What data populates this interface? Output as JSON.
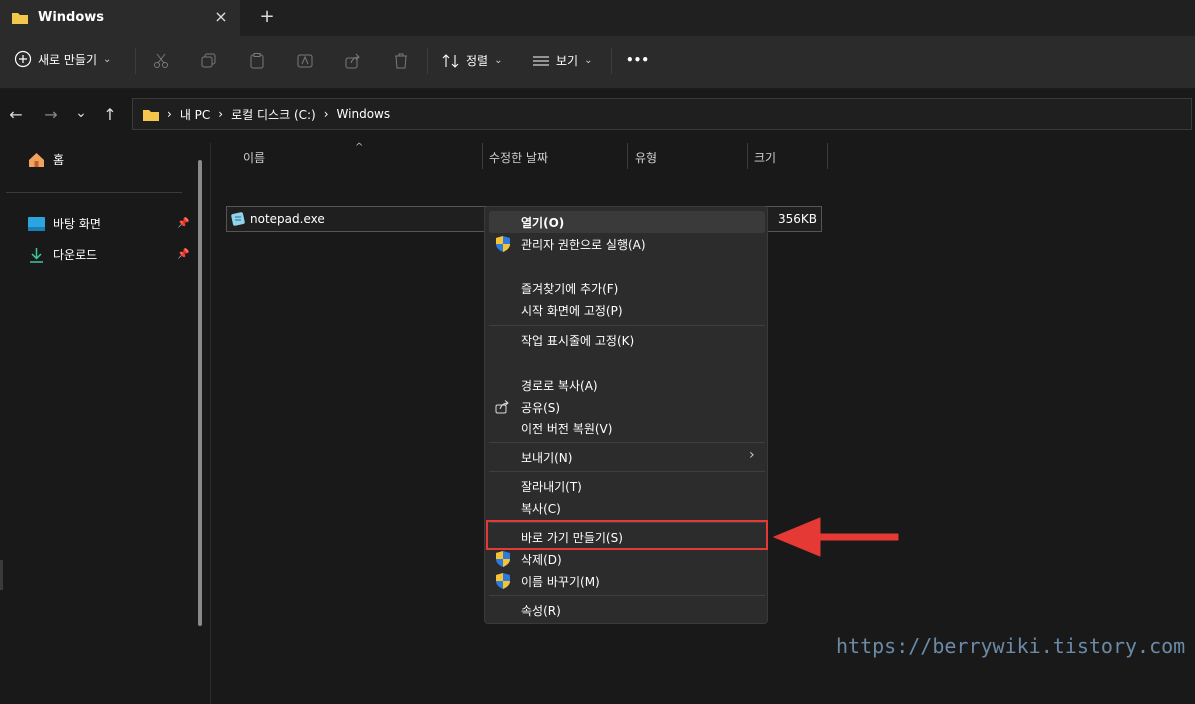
{
  "tab": {
    "title": "Windows",
    "close_icon": "×",
    "add_icon": "+"
  },
  "toolbar": {
    "new_label": "새로 만들기",
    "sort_label": "정렬",
    "view_label": "보기",
    "more_label": "•••",
    "chevron": "⌄"
  },
  "nav": {
    "back": "←",
    "forward": "→",
    "recent": "⌄",
    "up": "↑"
  },
  "address": {
    "path": [
      "내 PC",
      "로컬 디스크 (C:)",
      "Windows"
    ],
    "sep": "›"
  },
  "sidebar": {
    "home": "홈",
    "items": [
      {
        "label": "바탕 화면"
      },
      {
        "label": "다운로드"
      }
    ]
  },
  "columns": {
    "sort_arrow": "^",
    "name": "이름",
    "modified": "수정한 날짜",
    "type": "유형",
    "size": "크기"
  },
  "file": {
    "name": "notepad.exe",
    "size": "356KB"
  },
  "context_menu": {
    "open": "열기(O)",
    "run_admin": "관리자 권한으로 실행(A)",
    "add_favorites": "즐겨찾기에 추가(F)",
    "pin_start": "시작 화면에 고정(P)",
    "pin_taskbar": "작업 표시줄에 고정(K)",
    "copy_path": "경로로 복사(A)",
    "share": "공유(S)",
    "restore_prev": "이전 버전 복원(V)",
    "send_to": "보내기(N)",
    "send_to_chevron": "›",
    "cut": "잘라내기(T)",
    "copy": "복사(C)",
    "create_shortcut": "바로 가기 만들기(S)",
    "delete": "삭제(D)",
    "rename": "이름 바꾸기(M)",
    "properties": "속성(R)"
  },
  "annotation_arrow_color": "#e53935",
  "watermark": "https://berrywiki.tistory.com"
}
